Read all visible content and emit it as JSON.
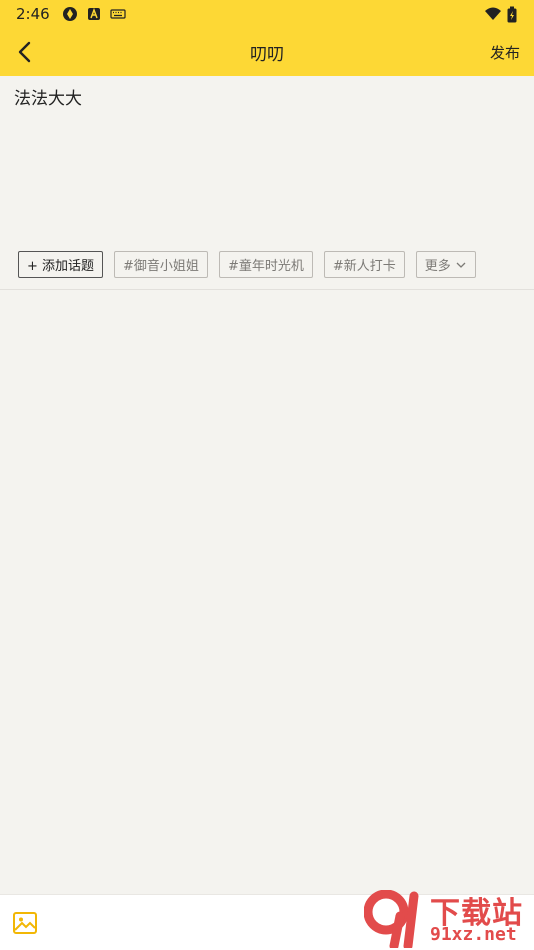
{
  "status_bar": {
    "time": "2:46",
    "icons_left": [
      "shutter-icon",
      "a-badge-icon",
      "keyboard-icon"
    ],
    "icons_right": [
      "wifi-icon",
      "battery-charging-icon"
    ]
  },
  "app_bar": {
    "title": "叨叨",
    "publish_label": "发布",
    "background": "#fdd835"
  },
  "editor": {
    "text": "法法大大"
  },
  "topics": {
    "add_label": "+ 添加话题",
    "items": [
      "#御音小姐姐",
      "#童年时光机",
      "#新人打卡"
    ],
    "more_label": "更多"
  },
  "bottom_bar": {
    "image_icon": "image-icon",
    "accent": "#f2b705"
  },
  "watermark": {
    "title": "下载站",
    "url": "91xz.net",
    "color": "#e24b4b"
  }
}
